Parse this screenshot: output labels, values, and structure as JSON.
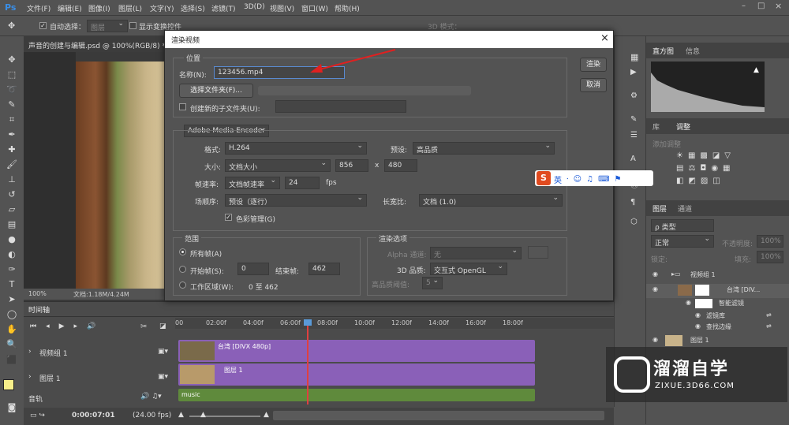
{
  "menu": [
    "文件(F)",
    "编辑(E)",
    "图像(I)",
    "图层(L)",
    "文字(Y)",
    "选择(S)",
    "滤镜(T)",
    "3D(D)",
    "视图(V)",
    "窗口(W)",
    "帮助(H)"
  ],
  "options": {
    "auto_select": "自动选择：",
    "auto_select_value": "图层",
    "show_transform": "显示变换控件",
    "mode3d": "3D 模式："
  },
  "document_tab": "声音的创建与编辑.psd @ 100%(RGB/8) *",
  "status": {
    "zoom": "100%",
    "doc": "文档:1.18M/4.24M"
  },
  "dialog": {
    "title": "渲染视频",
    "location_label": "位置",
    "name_label": "名称(N):",
    "name_value": "123456.mp4",
    "select_folder": "选择文件夹(F)...",
    "subfolder_label": "创建新的子文件夹(U):",
    "encoder": "Adobe Media Encoder",
    "format_label": "格式:",
    "format_value": "H.264",
    "preset_label": "预设:",
    "preset_value": "高品质",
    "size_label": "大小:",
    "size_value": "文档大小",
    "width": "856",
    "x": "x",
    "height": "480",
    "framerate_label": "帧速率:",
    "framerate_value": "文档帧速率",
    "fps_value": "24",
    "fps_unit": "fps",
    "field_order_label": "场顺序:",
    "field_order_value": "预设（逐行）",
    "aspect_label": "长宽比:",
    "aspect_value": "文档 (1.0)",
    "color_mgmt": "色彩管理(G)",
    "range_label": "范围",
    "all_frames": "所有帧(A)",
    "start_frame": "开始帧(S):",
    "start_value": "0",
    "end_frame": "结束帧:",
    "end_value": "462",
    "work_area": "工作区域(W):",
    "work_area_value": "0 至 462",
    "render_options": "渲染选项",
    "alpha_label": "Alpha 通道:",
    "alpha_value": "无",
    "quality_label": "3D 品质:",
    "quality_value": "交互式 OpenGL",
    "hq_label": "高品质阈值:",
    "hq_value": "5",
    "render_button": "渲染",
    "cancel_button": "取消",
    "close": "×"
  },
  "ime": {
    "s": "S",
    "lang": "英"
  },
  "right_panel": {
    "tabs1": [
      "直方图",
      "信息"
    ],
    "tabs2": [
      "库",
      "调整"
    ],
    "add_adjust": "添加调整",
    "tabs3": [
      "图层",
      "通道"
    ],
    "kind": "ρ 类型",
    "blend": "正常",
    "opacity_label": "不透明度:",
    "opacity_value": "100%",
    "lock_label": "锁定:",
    "fill_label": "填充:",
    "fill_value": "100%",
    "layers": [
      {
        "name": "视频组 1"
      },
      {
        "name": "台湾 [DIV..."
      },
      {
        "name": "智能滤镜"
      },
      {
        "name": "滤镜库"
      },
      {
        "name": "查找边缘"
      },
      {
        "name": "图层 1"
      }
    ]
  },
  "timeline": {
    "tab": "时间轴",
    "ruler": [
      "00",
      "02:00f",
      "04:00f",
      "06:00f",
      "08:00f",
      "10:00f",
      "12:00f",
      "14:00f",
      "16:00f",
      "18:00f"
    ],
    "tracks": [
      {
        "label": "视频组 1",
        "clip": "台湾 [DIVX 480p]"
      },
      {
        "label": "图层 1",
        "clip": "图层 1"
      },
      {
        "label": "音轨",
        "clip": "music"
      }
    ],
    "timecode": "0:00:07:01",
    "fps": "(24.00 fps)"
  },
  "watermark": {
    "title": "溜溜自学",
    "url": "ZIXUE.3D66.COM"
  },
  "colors": {
    "video_track": "#8a60b8",
    "audio_track": "#5f8a3c",
    "playhead": "#e04040",
    "arrow": "#e02020"
  }
}
